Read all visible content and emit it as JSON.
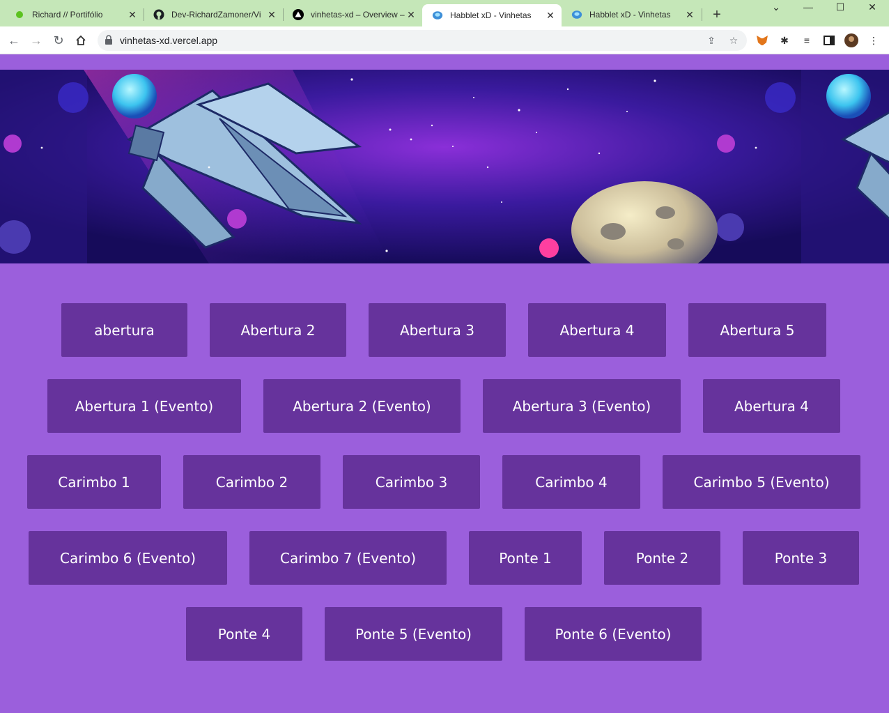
{
  "browser": {
    "tabs": [
      {
        "title": "Richard // Portifólio",
        "icon": "green-dot-icon"
      },
      {
        "title": "Dev-RichardZamoner/Vi",
        "icon": "github-icon"
      },
      {
        "title": "vinhetas-xd – Overview –",
        "icon": "vercel-icon"
      },
      {
        "title": "Habblet xD - Vinhetas",
        "icon": "habblet-icon",
        "active": true
      },
      {
        "title": "Habblet xD - Vinhetas",
        "icon": "habblet-icon"
      }
    ],
    "url": "vinhetas-xd.vercel.app"
  },
  "colors": {
    "page_background": "#9b5fdc",
    "button_background": "#66339c",
    "button_text": "#ffffff",
    "tabstrip": "#c5e7b8"
  },
  "buttons": [
    "abertura",
    "Abertura 2",
    "Abertura 3",
    "Abertura 4",
    "Abertura 5",
    "Abertura 1 (Evento)",
    "Abertura 2 (Evento)",
    "Abertura 3 (Evento)",
    "Abertura 4",
    "Carimbo 1",
    "Carimbo 2",
    "Carimbo 3",
    "Carimbo 4",
    "Carimbo 5 (Evento)",
    "Carimbo 6 (Evento)",
    "Carimbo 7 (Evento)",
    "Ponte 1",
    "Ponte 2",
    "Ponte 3",
    "Ponte 4",
    "Ponte 5 (Evento)",
    "Ponte 6 (Evento)"
  ]
}
